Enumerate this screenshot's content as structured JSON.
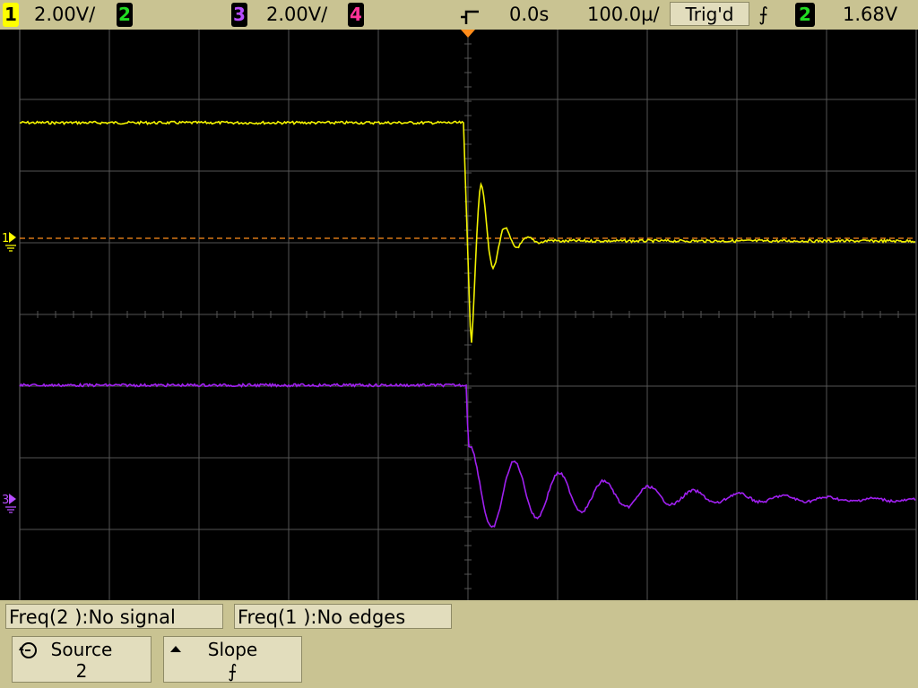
{
  "header": {
    "ch1": {
      "num": "1",
      "scale": "2.00V/",
      "color": "#ffff00"
    },
    "ch2": {
      "num": "2",
      "color": "#22dd22"
    },
    "ch3": {
      "num": "3",
      "scale": "2.00V/",
      "color": "#b84dff"
    },
    "ch4": {
      "num": "4",
      "color": "#ff3399"
    },
    "time_offset": "0.0s",
    "time_scale": "100.0µ/",
    "trig_status": "Trig'd",
    "trig_slope_symbol": "⨍",
    "trig_source": "2",
    "trig_level": "1.68V"
  },
  "screen": {
    "ch1_marker": "1",
    "ch3_marker": "3",
    "trace_colors": {
      "ch1": "#f2f200",
      "ch3": "#a020f0",
      "grid": "#555555",
      "ref": "#ff8c1a"
    }
  },
  "measurements": [
    {
      "label": "Freq(2 ):No signal"
    },
    {
      "label": "Freq(1 ):No edges"
    }
  ],
  "softkeys": {
    "source": {
      "label": "Source",
      "value": "2",
      "icon": "rotate-knob-icon"
    },
    "slope": {
      "label": "Slope",
      "value": "⨍",
      "icon": "up-triangle-icon"
    }
  }
}
